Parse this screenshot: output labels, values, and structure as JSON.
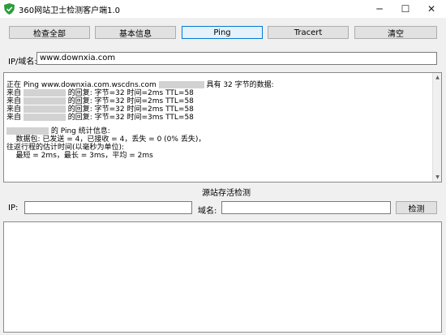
{
  "window": {
    "title": "360网站卫士检测客户端1.0",
    "controls": {
      "minimize": "─",
      "maximize": "☐",
      "close": "✕"
    }
  },
  "toolbar": {
    "buttons": [
      {
        "label": "检查全部"
      },
      {
        "label": "基本信息"
      },
      {
        "label": "Ping",
        "active": true
      },
      {
        "label": "Tracert"
      },
      {
        "label": "清空"
      }
    ]
  },
  "domain_field": {
    "label": "IP/域名:",
    "value": "www.downxia.com"
  },
  "output": {
    "lines": [
      "正在 Ping www.downxia.com.wscdns.com [redacted] 具有 32 字节的数据:",
      "来自 [redacted] 的回复: 字节=32 时间=2ms TTL=58",
      "来自 [redacted] 的回复: 字节=32 时间=2ms TTL=58",
      "来自 [redacted] 的回复: 字节=32 时间=2ms TTL=58",
      "来自 [redacted] 的回复: 字节=32 时间=3ms TTL=58",
      "",
      "[redacted] 的 Ping 统计信息:",
      "    数据包: 已发送 = 4，已接收 = 4，丢失 = 0 (0% 丢失)，",
      "往返行程的估计时间(以毫秒为单位):",
      "    最短 = 2ms，最长 = 3ms，平均 = 2ms"
    ]
  },
  "origin_check": {
    "title": "源站存活检测",
    "ip_label": "IP:",
    "ip_value": "",
    "domain_label": "域名:",
    "domain_value": "",
    "check_button": "检测"
  },
  "colors": {
    "accent": "#0078d7",
    "window_bg": "#f0f0f0",
    "icon_green": "#2a9d3a"
  }
}
